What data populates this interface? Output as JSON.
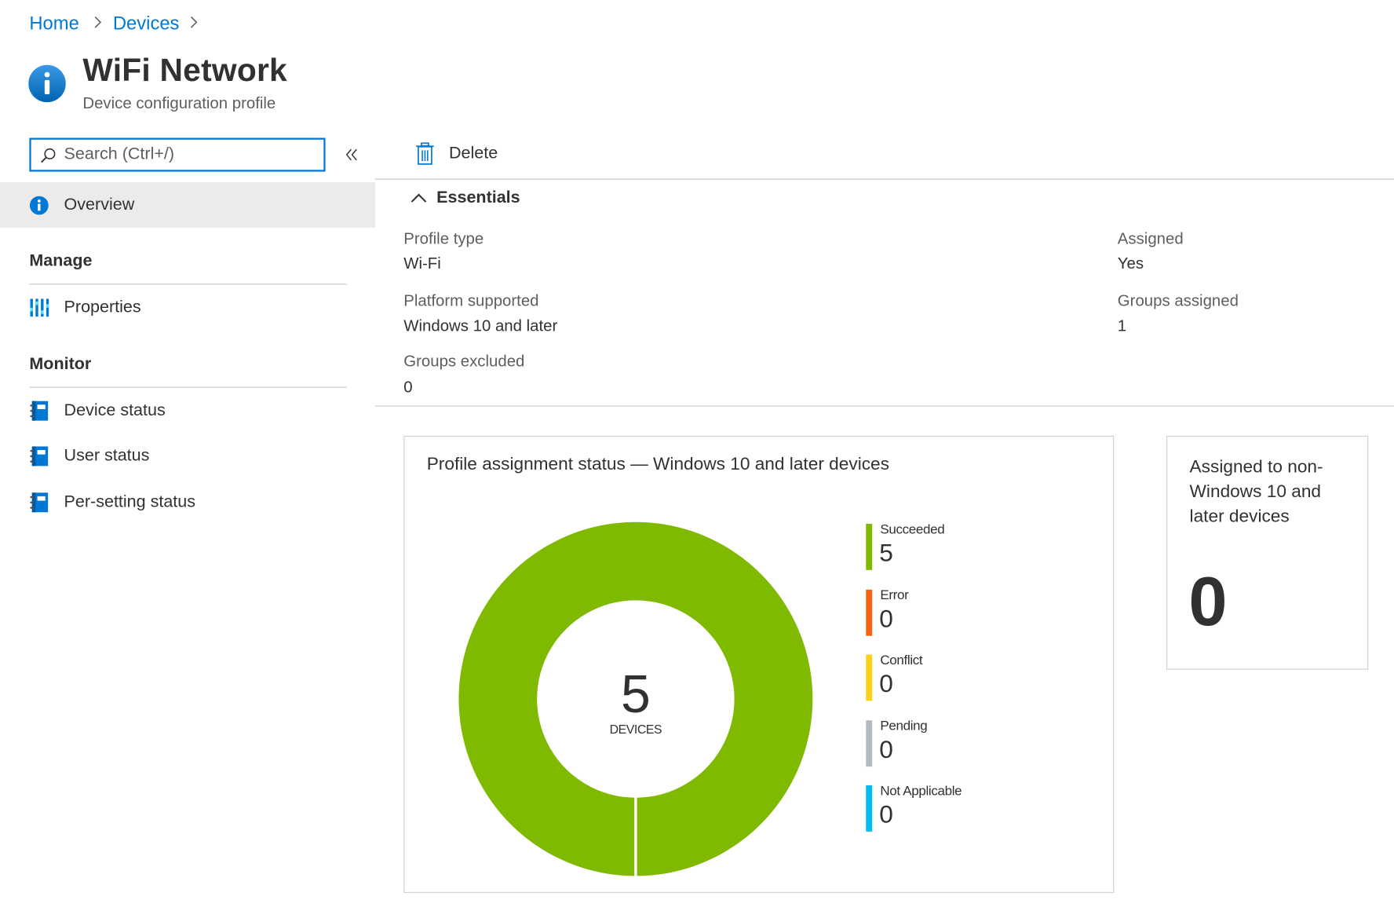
{
  "breadcrumb": {
    "home": "Home",
    "devices": "Devices",
    "sep": ">"
  },
  "header": {
    "title": "WiFi Network",
    "subtitle": "Device configuration profile",
    "icon": "info-icon"
  },
  "sidebar": {
    "search_placeholder": "Search (Ctrl+/)",
    "collapse_glyph": "«",
    "overview_label": "Overview",
    "manage_heading": "Manage",
    "properties_label": "Properties",
    "monitor_heading": "Monitor",
    "monitor_items": [
      "Device status",
      "User status",
      "Per-setting status"
    ]
  },
  "toolbar": {
    "delete_label": "Delete"
  },
  "essentials": {
    "heading": "Essentials",
    "left": [
      {
        "label": "Profile type",
        "value": "Wi-Fi"
      },
      {
        "label": "Platform supported",
        "value": "Windows 10 and later"
      },
      {
        "label": "Groups excluded",
        "value": "0"
      }
    ],
    "right": [
      {
        "label": "Assigned",
        "value": "Yes"
      },
      {
        "label": "Groups assigned",
        "value": "1"
      }
    ]
  },
  "status_card": {
    "title": "Profile assignment status — Windows 10 and later devices",
    "center_value": "5",
    "center_label": "DEVICES"
  },
  "chart_data": {
    "type": "pie",
    "variant": "donut",
    "categories": [
      "Succeeded",
      "Error",
      "Conflict",
      "Pending",
      "Not Applicable"
    ],
    "values": [
      5,
      0,
      0,
      0,
      0
    ],
    "colors": [
      "#7fba00",
      "#f7630c",
      "#fcd116",
      "#b4b8c0",
      "#00bcf2"
    ],
    "total": 5,
    "total_label": "DEVICES"
  },
  "non_windows_card": {
    "title_lines": [
      "Assigned to non-",
      "Windows 10 and",
      "later devices"
    ],
    "value": "0"
  },
  "colors": {
    "accent": "#0078d4",
    "selected_bg": "#edebe9"
  }
}
